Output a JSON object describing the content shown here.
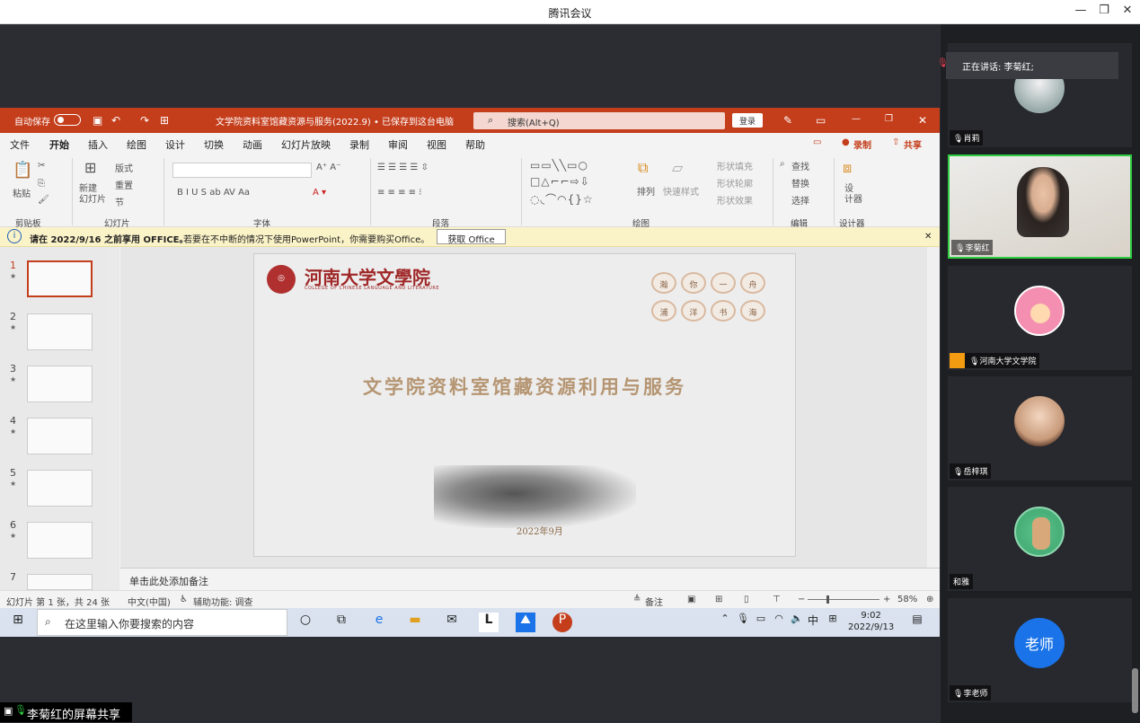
{
  "app": {
    "title": "腾讯会议",
    "share_label": "李菊红的屏幕共享",
    "speaking": "正在讲话: 李菊红;"
  },
  "participants": [
    {
      "name": "肖莉"
    },
    {
      "name": "李菊红"
    },
    {
      "name": "河南大学文学院"
    },
    {
      "name": "岳梓琪"
    },
    {
      "name": "和雅"
    },
    {
      "name": "李老师",
      "avatar_text": "老师",
      "avatar_color": "#1a73e8"
    }
  ],
  "ppt": {
    "autosave": "自动保存",
    "toggle_state": "关",
    "filename": "文学院资料室馆藏资源与服务(2022.9) • 已保存到这台电脑",
    "search_placeholder": "搜索(Alt+Q)",
    "login": "登录",
    "record": "录制",
    "share": "共享",
    "tabs": [
      "文件",
      "开始",
      "插入",
      "绘图",
      "设计",
      "切换",
      "动画",
      "幻灯片放映",
      "录制",
      "审阅",
      "视图",
      "帮助"
    ],
    "groups": [
      "剪贴板",
      "幻灯片",
      "字体",
      "段落",
      "绘图",
      "编辑",
      "设计器"
    ],
    "ribbon": {
      "paste": "粘贴",
      "new_slide": "新建\n幻灯片",
      "layout": "版式",
      "reset": "重置",
      "section": "节",
      "arrange": "排列",
      "quick_styles": "快速样式",
      "shape_fill": "形状填充",
      "shape_outline": "形状轮廓",
      "shape_effects": "形状效果",
      "find": "查找",
      "replace": "替换",
      "select": "选择",
      "designer": "设\n计器"
    },
    "info_bold": "请在 2022/9/16 之前享用 OFFICE。",
    "info_text": "若要在不中断的情况下使用PowerPoint，你需要购买Office。",
    "info_button": "获取 Office",
    "slide_numbers": [
      "1",
      "2",
      "3",
      "4",
      "5",
      "6",
      "7"
    ],
    "slide": {
      "school": "河南大学文學院",
      "school_en": "COLLEGE OF CHINESE LANGUAGE AND LITERATURE",
      "title": "文学院资料室馆藏资源利用与服务",
      "date": "2022年9月",
      "circles": [
        "瀚",
        "你",
        "一",
        "舟",
        "浦",
        "洋",
        "书",
        "海"
      ]
    },
    "notes_placeholder": "单击此处添加备注",
    "status": {
      "slide": "幻灯片 第 1 张，共 24 张",
      "lang": "中文(中国)",
      "access": "辅助功能: 调查",
      "notes": "备注",
      "zoom": "58%"
    }
  },
  "taskbar": {
    "search": "在这里输入你要搜索的内容",
    "time": "9:02",
    "date": "2022/9/13",
    "ime": "中"
  }
}
